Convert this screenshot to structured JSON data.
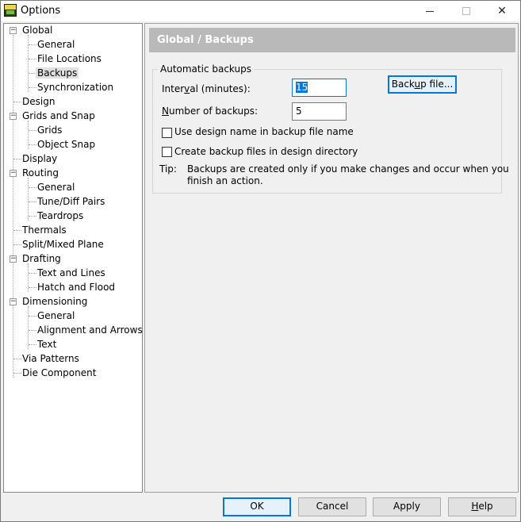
{
  "window": {
    "title": "Options",
    "app_icon": "pads-icon",
    "controls": {
      "minimize": "—",
      "close": "✕"
    }
  },
  "tree": {
    "items": [
      {
        "label": "Global",
        "expander": "−"
      },
      {
        "label": "General"
      },
      {
        "label": "File Locations"
      },
      {
        "label": "Backups",
        "selected": true
      },
      {
        "label": "Synchronization"
      },
      {
        "label": "Design"
      },
      {
        "label": "Grids and Snap",
        "expander": "−"
      },
      {
        "label": "Grids"
      },
      {
        "label": "Object Snap"
      },
      {
        "label": "Display"
      },
      {
        "label": "Routing",
        "expander": "−"
      },
      {
        "label": "General"
      },
      {
        "label": "Tune/Diff Pairs"
      },
      {
        "label": "Teardrops"
      },
      {
        "label": "Thermals"
      },
      {
        "label": "Split/Mixed Plane"
      },
      {
        "label": "Drafting",
        "expander": "−"
      },
      {
        "label": "Text and Lines"
      },
      {
        "label": "Hatch and Flood"
      },
      {
        "label": "Dimensioning",
        "expander": "−"
      },
      {
        "label": "General"
      },
      {
        "label": "Alignment and Arrows"
      },
      {
        "label": "Text"
      },
      {
        "label": "Via Patterns"
      },
      {
        "label": "Die Component"
      }
    ]
  },
  "panel": {
    "header": "Global / Backups",
    "group_title": "Automatic backups",
    "interval_label_pre": "Inter",
    "interval_label_key": "v",
    "interval_label_post": "al (minutes):",
    "interval_value": "15",
    "number_label_key": "N",
    "number_label_post": "umber of backups:",
    "number_value": "5",
    "backup_button_pre": "Back",
    "backup_button_key": "u",
    "backup_button_post": "p file...",
    "checkbox_design_name": "Use design name in backup file name",
    "checkbox_design_name_checked": false,
    "checkbox_design_dir": "Create backup files in design directory",
    "checkbox_design_dir_checked": false,
    "tip_label": "Tip:",
    "tip_line1": "Backups are created only if you make changes and occur when you",
    "tip_line2": "finish an action."
  },
  "footer": {
    "ok": "OK",
    "cancel": "Cancel",
    "apply": "Apply",
    "help_key": "H",
    "help_post": "elp"
  }
}
